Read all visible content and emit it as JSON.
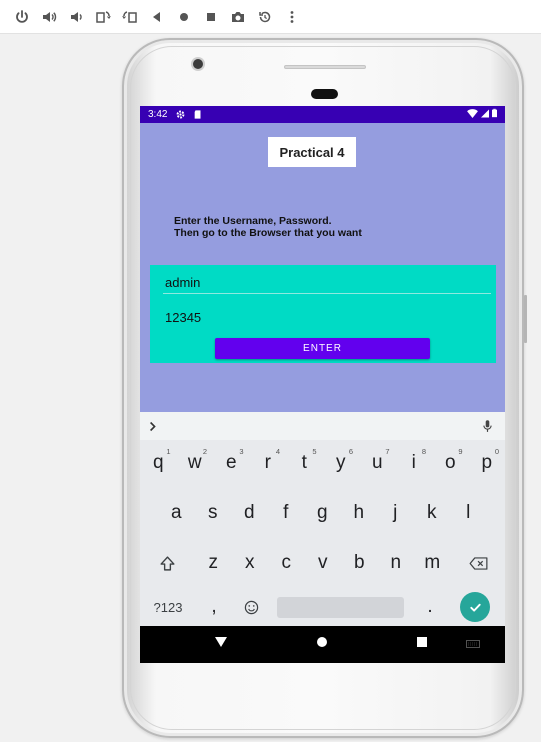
{
  "toolbar": {
    "buttons": [
      {
        "icon": "power-icon"
      },
      {
        "icon": "volume-up-icon"
      },
      {
        "icon": "volume-down-icon"
      },
      {
        "icon": "rotate-left-icon"
      },
      {
        "icon": "rotate-right-icon"
      },
      {
        "icon": "back-icon"
      },
      {
        "icon": "home-icon"
      },
      {
        "icon": "overview-icon"
      },
      {
        "icon": "camera-icon"
      },
      {
        "icon": "zoom-icon"
      },
      {
        "icon": "more-icon"
      }
    ]
  },
  "status_bar": {
    "time": "3:42",
    "left_icons": [
      "settings-icon",
      "sd-card-icon"
    ],
    "right_icons": [
      "wifi-icon",
      "signal-icon",
      "battery-icon"
    ],
    "color": "#3700b3"
  },
  "app": {
    "background": "#959ddf",
    "title": "Practical 4",
    "instruction_line1": "Enter the Username, Password.",
    "instruction_line2": "Then go to the Browser that you want",
    "form": {
      "background": "#00dbc5",
      "username_value": "admin",
      "password_value": "12345",
      "enter_label": "ENTER",
      "button_color": "#6200ee"
    }
  },
  "keyboard": {
    "row1": [
      {
        "key": "q",
        "hint": "1"
      },
      {
        "key": "w",
        "hint": "2"
      },
      {
        "key": "e",
        "hint": "3"
      },
      {
        "key": "r",
        "hint": "4"
      },
      {
        "key": "t",
        "hint": "5"
      },
      {
        "key": "y",
        "hint": "6"
      },
      {
        "key": "u",
        "hint": "7"
      },
      {
        "key": "i",
        "hint": "8"
      },
      {
        "key": "o",
        "hint": "9"
      },
      {
        "key": "p",
        "hint": "0"
      }
    ],
    "row2": [
      "a",
      "s",
      "d",
      "f",
      "g",
      "h",
      "j",
      "k",
      "l"
    ],
    "row3": [
      "z",
      "x",
      "c",
      "v",
      "b",
      "n",
      "m"
    ],
    "row4": {
      "symbols": "?123",
      "comma": ",",
      "period": "."
    },
    "icons": [
      "chevron-right-icon",
      "mic-icon",
      "shift-icon",
      "backspace-icon",
      "emoji-icon",
      "check-icon"
    ],
    "done_color": "#26a69a"
  },
  "nav_bar": {
    "icons": [
      "back-triangle-icon",
      "home-circle-icon",
      "recents-square-icon",
      "keyboard-switch-icon"
    ]
  }
}
